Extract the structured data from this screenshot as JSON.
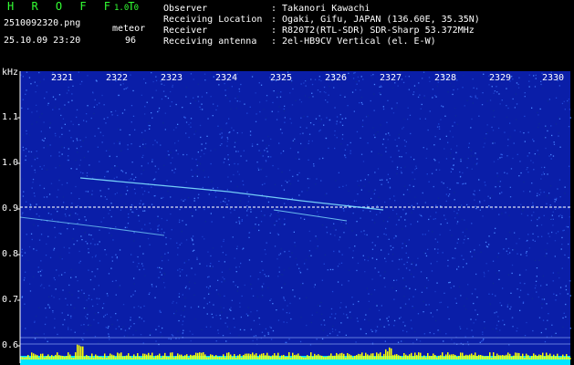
{
  "header": {
    "app_title": "H R O F F T",
    "app_version": "1.0.0",
    "file_name": "2510092320.png",
    "timestamp": "25.10.09 23:20",
    "meteor_label": "meteor",
    "meteor_count": "96",
    "info": [
      {
        "label": "Observer",
        "value": ": Takanori Kawachi"
      },
      {
        "label": "Receiving Location",
        "value": ": Ogaki, Gifu, JAPAN (136.60E, 35.35N)"
      },
      {
        "label": "Receiver",
        "value": ": R820T2(RTL-SDR) SDR-Sharp 53.372MHz"
      },
      {
        "label": "Receiving antenna",
        "value": ": 2el-HB9CV Vertical (el. E-W)"
      }
    ]
  },
  "spectrogram": {
    "unit": "kHz",
    "x_ticks": [
      "2321",
      "2322",
      "2323",
      "2324",
      "2325",
      "2326",
      "2327",
      "2328",
      "2329",
      "2330"
    ],
    "y_ticks": [
      "1.1",
      "1.0",
      "0.9",
      "0.8",
      "0.7",
      "0.6"
    ],
    "colors": {
      "background": "#0a1ea8",
      "trace": "#7fe0ff",
      "carrier": "#ffffff",
      "baseline": "#00e5ff",
      "peaks": "#ffff00"
    }
  }
}
